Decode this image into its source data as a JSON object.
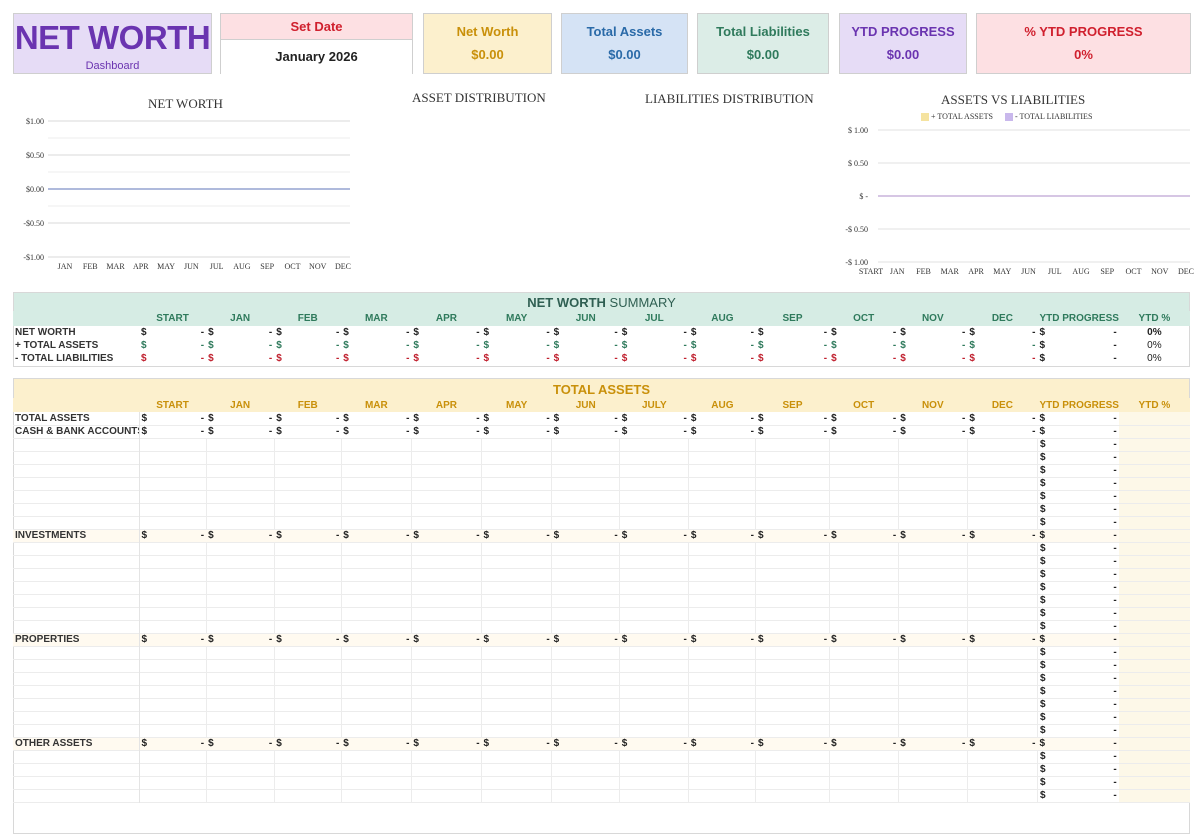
{
  "header": {
    "title": "NET WORTH",
    "subtitle": "Dashboard"
  },
  "cards": [
    {
      "title": "Set Date",
      "value": "January 2026",
      "title_bg": "#fde0e3",
      "title_color": "#d0202e"
    },
    {
      "title": "Net Worth",
      "value": "$0.00",
      "bg": "#fcf0cd",
      "color": "#c9900a"
    },
    {
      "title": "Total Assets",
      "value": "$0.00",
      "bg": "#d5e3f5",
      "color": "#2a6aa8"
    },
    {
      "title": "Total Liabilities",
      "value": "$0.00",
      "bg": "#dcede7",
      "color": "#2f7a5c"
    },
    {
      "title": "YTD PROGRESS",
      "value": "$0.00",
      "bg": "#e6dcf6",
      "color": "#6a34b0"
    },
    {
      "title": "% YTD PROGRESS",
      "value": "0%",
      "bg": "#fde0e3",
      "color": "#d0202e"
    }
  ],
  "charts": {
    "net_worth": {
      "title": "NET WORTH",
      "y_ticks": [
        "$1.00",
        "$0.50",
        "$0.00",
        "-$0.50",
        "-$1.00"
      ],
      "x_ticks": [
        "JAN",
        "FEB",
        "MAR",
        "APR",
        "MAY",
        "JUN",
        "JUL",
        "AUG",
        "SEP",
        "OCT",
        "NOV",
        "DEC"
      ]
    },
    "asset_distribution": {
      "title": "ASSET DISTRIBUTION"
    },
    "liabilities_distribution": {
      "title": "LIABILITIES DISTRIBUTION"
    },
    "assets_vs_liabilities": {
      "title": "ASSETS VS LIABILITIES",
      "legend": [
        "+ TOTAL ASSETS",
        "- TOTAL LIABILITIES"
      ],
      "y_ticks": [
        "$ 1.00",
        "$ 0.50",
        "$ -",
        "-$ 0.50",
        "-$ 1.00"
      ],
      "x_ticks": [
        "START",
        "JAN",
        "FEB",
        "MAR",
        "APR",
        "MAY",
        "JUN",
        "JUL",
        "AUG",
        "SEP",
        "OCT",
        "NOV",
        "DEC"
      ]
    }
  },
  "chart_data": [
    {
      "type": "line",
      "title": "NET WORTH",
      "categories": [
        "JAN",
        "FEB",
        "MAR",
        "APR",
        "MAY",
        "JUN",
        "JUL",
        "AUG",
        "SEP",
        "OCT",
        "NOV",
        "DEC"
      ],
      "series": [
        {
          "values": [
            0,
            0,
            0,
            0,
            0,
            0,
            0,
            0,
            0,
            0,
            0,
            0
          ]
        }
      ],
      "ylim": [
        -1,
        1
      ],
      "grid": true
    },
    {
      "type": "line",
      "title": "ASSETS VS LIABILITIES",
      "categories": [
        "START",
        "JAN",
        "FEB",
        "MAR",
        "APR",
        "MAY",
        "JUN",
        "JUL",
        "AUG",
        "SEP",
        "OCT",
        "NOV",
        "DEC"
      ],
      "series": [
        {
          "name": "+ TOTAL ASSETS",
          "values": [
            0,
            0,
            0,
            0,
            0,
            0,
            0,
            0,
            0,
            0,
            0,
            0,
            0
          ]
        },
        {
          "name": "- TOTAL LIABILITIES",
          "values": [
            0,
            0,
            0,
            0,
            0,
            0,
            0,
            0,
            0,
            0,
            0,
            0,
            0
          ]
        }
      ],
      "ylim": [
        -1,
        1
      ],
      "grid": true,
      "legend": "top"
    }
  ],
  "summary": {
    "title_bold": "NET WORTH",
    "title_rest": " SUMMARY",
    "columns": [
      "START",
      "JAN",
      "FEB",
      "MAR",
      "APR",
      "MAY",
      "JUN",
      "JUL",
      "AUG",
      "SEP",
      "OCT",
      "NOV",
      "DEC",
      "YTD PROGRESS",
      "YTD %"
    ],
    "rows": [
      {
        "label": "NET WORTH",
        "ytd_pct": "0%"
      },
      {
        "label": "+  TOTAL ASSETS",
        "ytd_pct": "0%"
      },
      {
        "label": "-   TOTAL LIABILITIES",
        "ytd_pct": "0%"
      }
    ]
  },
  "assets": {
    "title": "TOTAL ASSETS",
    "columns": [
      "START",
      "JAN",
      "FEB",
      "MAR",
      "APR",
      "MAY",
      "JUN",
      "JULY",
      "AUG",
      "SEP",
      "OCT",
      "NOV",
      "DEC",
      "YTD PROGRESS",
      "YTD %"
    ],
    "sections": [
      "TOTAL ASSETS",
      "CASH & BANK ACCOUNTS",
      "INVESTMENTS",
      "PROPERTIES",
      "OTHER ASSETS"
    ],
    "dollar": "$",
    "dash": "-"
  }
}
